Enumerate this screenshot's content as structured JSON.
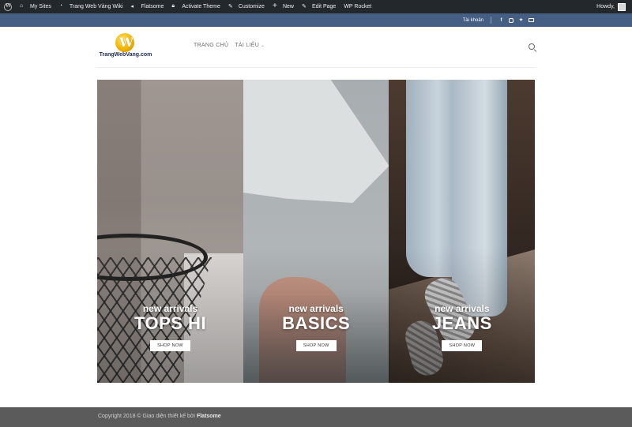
{
  "admin_bar": {
    "items": [
      "My Sites",
      "Trang Web Vàng Wiki",
      "Flatsome",
      "Activate Theme",
      "Customize",
      "New",
      "Edit Page",
      "WP Rocket"
    ],
    "howdy": "Howdy,"
  },
  "top_bar": {
    "account": "Tài khoản"
  },
  "header": {
    "logo_text": "TrangWebVang.com",
    "logo_letter": "W",
    "nav": [
      "TRANG CHỦ",
      "TÀI LIỆU"
    ]
  },
  "banners": [
    {
      "kicker": "new arrivals",
      "title": "TOPS HI",
      "button": "SHOP NOW"
    },
    {
      "kicker": "new arrivals",
      "title": "BASICS",
      "button": "SHOP NOW"
    },
    {
      "kicker": "new arrivals",
      "title": "JEANS",
      "button": "SHOP NOW"
    }
  ],
  "footer": {
    "prefix": "Copyright 2018 © Giao diện thiết kế bởi",
    "brand": "Flatsome"
  }
}
